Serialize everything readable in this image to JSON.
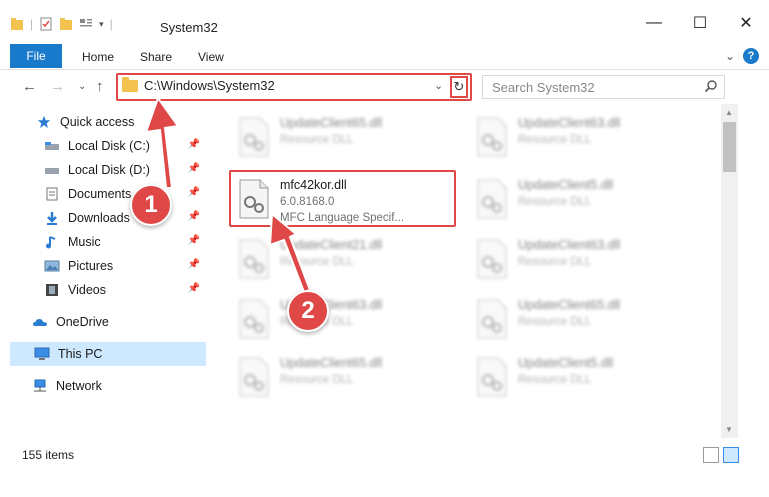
{
  "window": {
    "title": "System32",
    "minimize": "—",
    "maximize": "☐",
    "close": "✕"
  },
  "ribbon": {
    "tabs": [
      "File",
      "Home",
      "Share",
      "View"
    ],
    "expand": "⌄",
    "help": "?"
  },
  "nav": {
    "back": "←",
    "forward": "→",
    "recent": "⌄",
    "up": "↑",
    "address": "C:\\Windows\\System32",
    "address_dropdown": "⌄",
    "refresh": "↻",
    "search_placeholder": "Search System32"
  },
  "sidebar": {
    "quick_access": "Quick access",
    "items": [
      {
        "label": "Local Disk (C:)",
        "pinned": true,
        "icon": "drive-icon"
      },
      {
        "label": "Local Disk (D:)",
        "pinned": true,
        "icon": "drive-icon"
      },
      {
        "label": "Documents",
        "pinned": true,
        "icon": "documents-icon"
      },
      {
        "label": "Downloads",
        "pinned": true,
        "icon": "download-icon"
      },
      {
        "label": "Music",
        "pinned": true,
        "icon": "music-icon"
      },
      {
        "label": "Pictures",
        "pinned": true,
        "icon": "pictures-icon"
      },
      {
        "label": "Videos",
        "pinned": true,
        "icon": "videos-icon"
      }
    ],
    "onedrive": "OneDrive",
    "this_pc": "This PC",
    "network": "Network",
    "pin_glyph": "📌"
  },
  "files": {
    "highlighted": {
      "name": "mfc42kor.dll",
      "version": "6.0.8168.0",
      "description": "MFC Language Specif..."
    },
    "background": [
      {
        "name": "UpdateClient65.dll",
        "type": "Resource DLL"
      },
      {
        "name": "UpdateClient63.dll",
        "type": "Resource DLL"
      },
      {
        "name": "UpdateClient5.dll",
        "type": "Resource DLL"
      },
      {
        "name": "UpdateClient21.dll",
        "type": "Resource DLL"
      },
      {
        "name": "UpdateClient63.dll",
        "type": "Resource DLL"
      },
      {
        "name": "UpdateClient63.dll",
        "type": "Resource DLL"
      },
      {
        "name": "UpdateClient65.dll",
        "type": "Resource DLL"
      },
      {
        "name": "UpdateClient65.dll",
        "type": "Resource DLL"
      },
      {
        "name": "UpdateClient5.dll",
        "type": "Resource DLL"
      }
    ]
  },
  "status": {
    "item_count": "155 items"
  },
  "annotations": {
    "step1": "1",
    "step2": "2"
  },
  "colors": {
    "accent": "#1979ca",
    "highlight_red": "#e04848",
    "selected": "#cde8ff",
    "folder": "#f2c14e"
  }
}
